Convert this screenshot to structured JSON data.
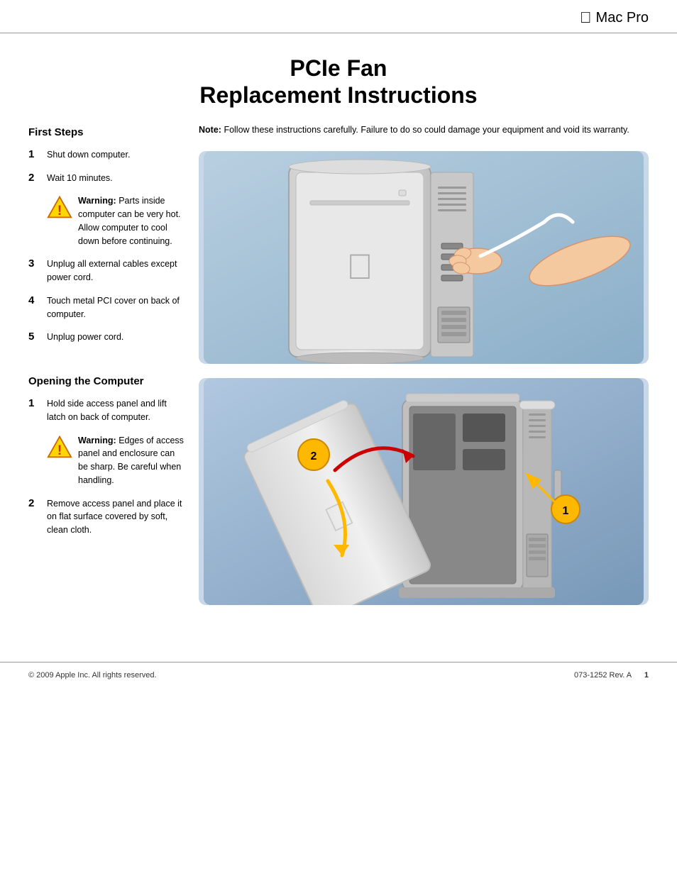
{
  "header": {
    "logo_icon": "apple-logo",
    "title": "Mac Pro"
  },
  "document": {
    "title_line1": "PCIe Fan",
    "title_line2": "Replacement Instructions"
  },
  "first_steps": {
    "heading": "First Steps",
    "note_label": "Note:",
    "note_text": "Follow these instructions carefully. Failure to do so could damage your equipment and void its warranty.",
    "steps": [
      {
        "number": "1",
        "text": "Shut down computer."
      },
      {
        "number": "2",
        "text": "Wait 10 minutes."
      },
      {
        "number": "3",
        "text": "Unplug all external cables except power cord."
      },
      {
        "number": "4",
        "text": "Touch metal PCI cover on back of computer."
      },
      {
        "number": "5",
        "text": "Unplug power cord."
      }
    ],
    "warning_label": "Warning:",
    "warning_text": "Parts inside computer can be very hot. Allow computer to cool down before continuing."
  },
  "opening": {
    "heading": "Opening the Computer",
    "steps": [
      {
        "number": "1",
        "text": "Hold side access panel and lift latch on back of computer."
      },
      {
        "number": "2",
        "text": "Remove access panel and place it on flat surface covered by soft, clean cloth."
      }
    ],
    "warning_label": "Warning:",
    "warning_text": "Edges of access panel and enclosure can be sharp. Be careful when handling."
  },
  "footer": {
    "copyright": "© 2009 Apple Inc. All rights reserved.",
    "doc_number": "073-1252 Rev. A",
    "page_number": "1"
  }
}
